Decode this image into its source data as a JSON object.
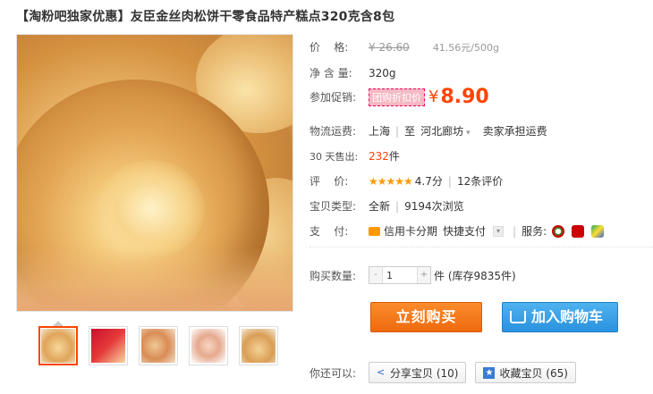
{
  "title": "【淘粉吧独家优惠】友臣金丝肉松饼干零食品特产糕点320克含8包",
  "thumbnails": [
    "thumb-1",
    "thumb-2",
    "thumb-3",
    "thumb-4",
    "thumb-5"
  ],
  "price": {
    "label": "价    格:",
    "original": "¥ 26.60",
    "unit": "41.56元/500g"
  },
  "weight": {
    "label": "净 含 量:",
    "value": "320g"
  },
  "promo": {
    "label": "参加促销:",
    "tag": "团购折扣价",
    "currency": "¥",
    "price": "8.90"
  },
  "shipping": {
    "label": "物流运费:",
    "from": "上海",
    "to_prefix": "至",
    "to": "河北廊坊",
    "note": "卖家承担运费"
  },
  "sold": {
    "label": "30 天售出:",
    "count": "232",
    "unit": "件"
  },
  "rating": {
    "label": "评    价:",
    "stars": "★★★★★",
    "score": "4.7分",
    "reviews": "12条评价"
  },
  "type": {
    "label": "宝贝类型:",
    "value": "全新",
    "views": "9194次浏览"
  },
  "payment": {
    "label": "支    付:",
    "method1": "信用卡分期",
    "method2": "快捷支付",
    "service_label": "服务:"
  },
  "quantity": {
    "label": "购买数量:",
    "value": "1",
    "stock": "件 (库存9835件)"
  },
  "buttons": {
    "buy_now": "立刻购买",
    "add_cart": "加入购物车"
  },
  "share": {
    "label": "你还可以:",
    "share_btn": "分享宝贝 (10)",
    "fav_btn": "收藏宝贝 (65)"
  },
  "colors": {
    "accent": "#ff4400",
    "buy": "#ee6a0e",
    "cart": "#2a92de"
  }
}
